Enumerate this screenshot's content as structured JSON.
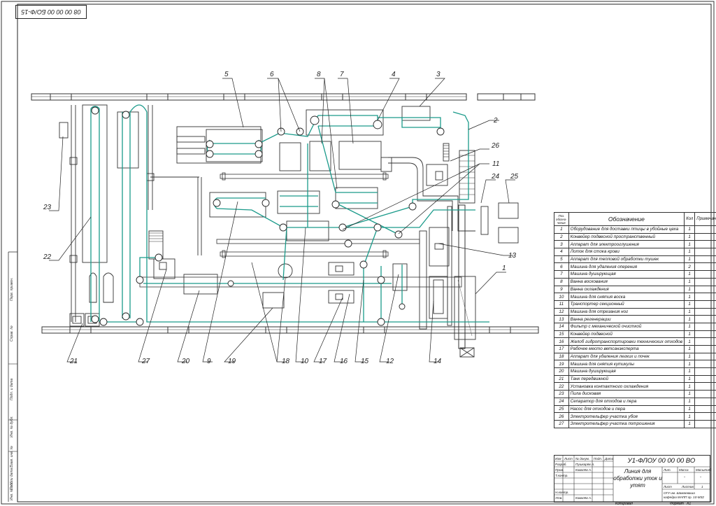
{
  "drawing": {
    "top_stamp": "08 00 00 00 БО/Ф-15",
    "callouts": [
      "1",
      "2",
      "3",
      "4",
      "5",
      "6",
      "7",
      "8",
      "9",
      "10",
      "11",
      "12",
      "13",
      "14",
      "15",
      "16",
      "17",
      "18",
      "19",
      "20",
      "21",
      "22",
      "23",
      "24",
      "25",
      "26",
      "27"
    ]
  },
  "colors": {
    "conveyor": "#1a9a8a",
    "line": "#222222",
    "paper": "#ffffff"
  },
  "spec": {
    "headers": {
      "pos": "Поз. обозна- чение",
      "name": "Обозначение",
      "qty": "Кол",
      "note": "Примечание"
    },
    "rows": [
      {
        "pos": "1",
        "name": "Оборудование для доставки птицы в убойные цеха",
        "qty": "1",
        "note": ""
      },
      {
        "pos": "2",
        "name": "Конвейер подвесной пространственный",
        "qty": "1",
        "note": ""
      },
      {
        "pos": "3",
        "name": "Аппарат для электрооглушения",
        "qty": "1",
        "note": ""
      },
      {
        "pos": "4",
        "name": "Лоток для стока крови",
        "qty": "1",
        "note": ""
      },
      {
        "pos": "5",
        "name": "Аппарат для тепловой обработки тушек",
        "qty": "1",
        "note": ""
      },
      {
        "pos": "6",
        "name": "Машина для удаления оперения",
        "qty": "2",
        "note": ""
      },
      {
        "pos": "7",
        "name": "Машина душирующая",
        "qty": "1",
        "note": ""
      },
      {
        "pos": "8",
        "name": "Ванна воскования",
        "qty": "1",
        "note": ""
      },
      {
        "pos": "9",
        "name": "Ванна охлаждения",
        "qty": "1",
        "note": ""
      },
      {
        "pos": "10",
        "name": "Машина для снятия воска",
        "qty": "1",
        "note": ""
      },
      {
        "pos": "11",
        "name": "Транспортер секционный",
        "qty": "1",
        "note": ""
      },
      {
        "pos": "12",
        "name": "Машина для отрезания ног",
        "qty": "1",
        "note": ""
      },
      {
        "pos": "13",
        "name": "Ванна регенерации",
        "qty": "1",
        "note": ""
      },
      {
        "pos": "14",
        "name": "Фильтр с механической очисткой",
        "qty": "1",
        "note": ""
      },
      {
        "pos": "15",
        "name": "Конвейер подвесной",
        "qty": "1",
        "note": ""
      },
      {
        "pos": "16",
        "name": "Желоб гидротранспортировки технических отходов",
        "qty": "1",
        "note": ""
      },
      {
        "pos": "17",
        "name": "Рабочее место ветсанэксперта",
        "qty": "1",
        "note": ""
      },
      {
        "pos": "18",
        "name": "Аппарат для удаления легких и почек",
        "qty": "1",
        "note": ""
      },
      {
        "pos": "19",
        "name": "Машина для снятия кутикулы",
        "qty": "1",
        "note": ""
      },
      {
        "pos": "20",
        "name": "Машина душирующая",
        "qty": "1",
        "note": ""
      },
      {
        "pos": "21",
        "name": "Танк передвижной",
        "qty": "1",
        "note": ""
      },
      {
        "pos": "22",
        "name": "Установка контактного охлаждения",
        "qty": "1",
        "note": ""
      },
      {
        "pos": "23",
        "name": "Пила дисковая",
        "qty": "1",
        "note": ""
      },
      {
        "pos": "24",
        "name": "Сепаратор для отходов и пера",
        "qty": "1",
        "note": ""
      },
      {
        "pos": "25",
        "name": "Насос для отходов и пера",
        "qty": "1",
        "note": ""
      },
      {
        "pos": "26",
        "name": "Электротельфер участка убоя",
        "qty": "1",
        "note": ""
      },
      {
        "pos": "27",
        "name": "Электротельфер участка потрошения",
        "qty": "1",
        "note": ""
      }
    ]
  },
  "title_block": {
    "code": "У1-ФЛОУ 00 00 00 ВО",
    "name": "Линия для обработки уток и утят",
    "org": "ОГУ им. Шамаеваша кафедра МАПП гр. 10-МЗ2",
    "litera": "Лит.",
    "mass": "Масса",
    "scale": "Масштаб",
    "sheet": "Лист",
    "sheets": "Листов",
    "sheets_count": "1",
    "dash1": "-",
    "dash2": "-",
    "copied": "Копировал",
    "format": "Формат",
    "format_value": "А1",
    "roles": [
      "Изм",
      "Лист",
      "№ докум.",
      "Подп.",
      "Дата",
      "Разраб.",
      "Пров.",
      "Т.контр.",
      "Н.контр.",
      "Утв."
    ],
    "people": [
      "Пушкарёв А.",
      "Ковалёв А.",
      "Ковалёв А."
    ]
  },
  "left_strip": [
    "Перв. примен.",
    "Справ. №",
    "Подп. и дата",
    "Инв. № дубл.",
    "Взам. инв. №",
    "Подп. и дата",
    "Инв. № подл."
  ]
}
